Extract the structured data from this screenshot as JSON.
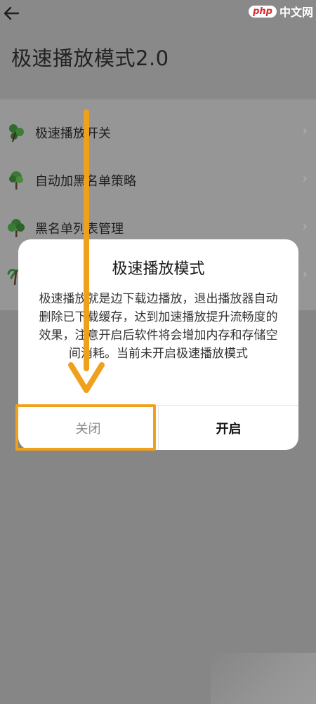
{
  "header": {
    "title": "极速播放模式2.0",
    "back_icon": "arrow-left-icon"
  },
  "watermark": {
    "logo": "php",
    "text": "中文网"
  },
  "settings": {
    "items": [
      {
        "label": "极速播放开关",
        "icon": "leaf-icon"
      },
      {
        "label": "自动加黑名单策略",
        "icon": "tree-icon"
      },
      {
        "label": "黑名单列表管理",
        "icon": "tree-icon"
      },
      {
        "label": "",
        "icon": "palm-tree-icon"
      }
    ]
  },
  "dialog": {
    "title": "极速播放模式",
    "message": "极速播放就是边下载边播放，退出播放器自动删除已下载缓存，达到加速播放提升流畅度的效果，注意开启后软件将会增加内存和存储空间消耗。当前未开启极速播放模式",
    "cancel_label": "关闭",
    "confirm_label": "开启"
  },
  "colors": {
    "overlay": "#8c8c8c",
    "dialog_bg": "#ffffff",
    "annotation_orange": "#f0a11c",
    "icon_green": "#2e6b2e"
  }
}
